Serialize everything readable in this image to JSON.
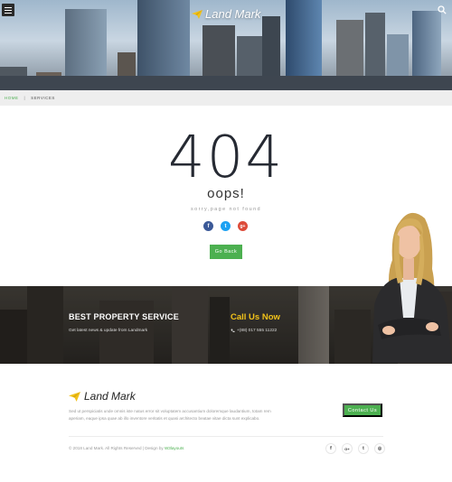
{
  "header": {
    "brand_name": "Land Mark",
    "menu_icon": "hamburger-menu-icon",
    "search_icon": "search-icon"
  },
  "breadcrumb": {
    "home": "HOME",
    "separator": "|",
    "current": "SERVICES"
  },
  "error": {
    "code": "404",
    "title": "oops!",
    "subtitle": "sorry,page not found",
    "go_back_label": "Go Back"
  },
  "social": [
    {
      "name": "facebook-icon",
      "glyph": "f",
      "color": "#3b5998"
    },
    {
      "name": "twitter-icon",
      "glyph": "t",
      "color": "#1da1f2"
    },
    {
      "name": "google-plus-icon",
      "glyph": "g+",
      "color": "#dd4b39"
    }
  ],
  "cta": {
    "title": "BEST PROPERTY SERVICE",
    "subtitle": "Get latest news & update from Landmark",
    "call_title": "Call Us Now",
    "phone": "+(88) 017 555 11222"
  },
  "footer": {
    "brand_name": "Land Mark",
    "description": "Sed ut perspiciatis unde omnis iste natus error sit voluptatem accusantium doloremque laudantium, totam rem aperiam, eaque ipsa quae ab illo inventore veritatis et quasi architecto beatae vitae dicta sunt explicabo.",
    "contact_label": "Contact Us",
    "copyright_prefix": "© 2018 Land Mark. All Rights Reserved | Design by",
    "copyright_link": "W3layouts",
    "social": [
      {
        "name": "facebook-icon",
        "glyph": "f"
      },
      {
        "name": "google-plus-icon",
        "glyph": "G+"
      },
      {
        "name": "twitter-icon",
        "glyph": "t"
      },
      {
        "name": "dribbble-icon",
        "glyph": "◎"
      }
    ]
  },
  "colors": {
    "accent_green": "#4cb050",
    "accent_yellow": "#f2c21a",
    "dark_text": "#262a33"
  }
}
